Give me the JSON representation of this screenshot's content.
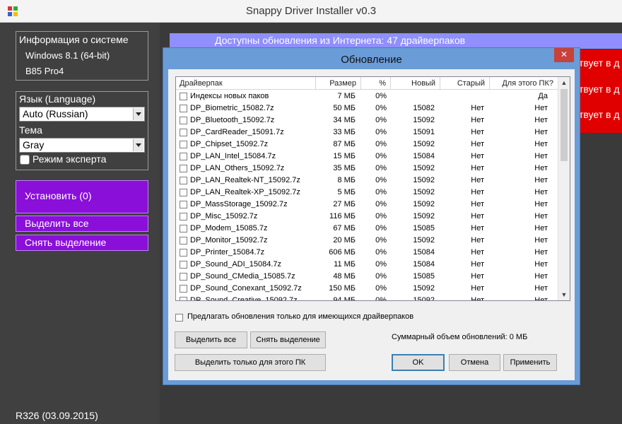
{
  "window": {
    "title": "Snappy Driver Installer v0.3"
  },
  "left_panel": {
    "system_info": {
      "heading": "Информация о системе",
      "os": "Windows 8.1 (64-bit)",
      "board": "B85 Pro4"
    },
    "language_label": "Язык (Language)",
    "language_value": "Auto (Russian)",
    "theme_label": "Тема",
    "theme_value": "Gray",
    "expert_mode_label": "Режим эксперта",
    "install_button": "Установить (0)",
    "select_all_button": "Выделить все",
    "deselect_button": "Снять выделение",
    "revision": "R326 (03.09.2015)"
  },
  "background": {
    "updates_banner": "Доступны обновления из Интернета: 47 драйверпаков",
    "red_rows": [
      "твует в д",
      "твует в д",
      "твует в д"
    ]
  },
  "dialog": {
    "title": "Обновление",
    "close_glyph": "✕",
    "columns": [
      "Драйверпак",
      "Размер",
      "%",
      "Новый",
      "Старый",
      "Для этого ПК?"
    ],
    "rows": [
      {
        "name": "Индексы новых паков",
        "size": "7 МБ",
        "pct": "0%",
        "new": "",
        "old": "",
        "for_pc": "Да"
      },
      {
        "name": "DP_Biometric_15082.7z",
        "size": "50 МБ",
        "pct": "0%",
        "new": "15082",
        "old": "Нет",
        "for_pc": "Нет"
      },
      {
        "name": "DP_Bluetooth_15092.7z",
        "size": "34 МБ",
        "pct": "0%",
        "new": "15092",
        "old": "Нет",
        "for_pc": "Нет"
      },
      {
        "name": "DP_CardReader_15091.7z",
        "size": "33 МБ",
        "pct": "0%",
        "new": "15091",
        "old": "Нет",
        "for_pc": "Нет"
      },
      {
        "name": "DP_Chipset_15092.7z",
        "size": "87 МБ",
        "pct": "0%",
        "new": "15092",
        "old": "Нет",
        "for_pc": "Нет"
      },
      {
        "name": "DP_LAN_Intel_15084.7z",
        "size": "15 МБ",
        "pct": "0%",
        "new": "15084",
        "old": "Нет",
        "for_pc": "Нет"
      },
      {
        "name": "DP_LAN_Others_15092.7z",
        "size": "35 МБ",
        "pct": "0%",
        "new": "15092",
        "old": "Нет",
        "for_pc": "Нет"
      },
      {
        "name": "DP_LAN_Realtek-NT_15092.7z",
        "size": "8 МБ",
        "pct": "0%",
        "new": "15092",
        "old": "Нет",
        "for_pc": "Нет"
      },
      {
        "name": "DP_LAN_Realtek-XP_15092.7z",
        "size": "5 МБ",
        "pct": "0%",
        "new": "15092",
        "old": "Нет",
        "for_pc": "Нет"
      },
      {
        "name": "DP_MassStorage_15092.7z",
        "size": "27 МБ",
        "pct": "0%",
        "new": "15092",
        "old": "Нет",
        "for_pc": "Нет"
      },
      {
        "name": "DP_Misc_15092.7z",
        "size": "116 МБ",
        "pct": "0%",
        "new": "15092",
        "old": "Нет",
        "for_pc": "Нет"
      },
      {
        "name": "DP_Modem_15085.7z",
        "size": "67 МБ",
        "pct": "0%",
        "new": "15085",
        "old": "Нет",
        "for_pc": "Нет"
      },
      {
        "name": "DP_Monitor_15092.7z",
        "size": "20 МБ",
        "pct": "0%",
        "new": "15092",
        "old": "Нет",
        "for_pc": "Нет"
      },
      {
        "name": "DP_Printer_15084.7z",
        "size": "606 МБ",
        "pct": "0%",
        "new": "15084",
        "old": "Нет",
        "for_pc": "Нет"
      },
      {
        "name": "DP_Sound_ADI_15084.7z",
        "size": "11 МБ",
        "pct": "0%",
        "new": "15084",
        "old": "Нет",
        "for_pc": "Нет"
      },
      {
        "name": "DP_Sound_CMedia_15085.7z",
        "size": "48 МБ",
        "pct": "0%",
        "new": "15085",
        "old": "Нет",
        "for_pc": "Нет"
      },
      {
        "name": "DP_Sound_Conexant_15092.7z",
        "size": "150 МБ",
        "pct": "0%",
        "new": "15092",
        "old": "Нет",
        "for_pc": "Нет"
      },
      {
        "name": "DP_Sound_Creative_15092.7z",
        "size": "94 МБ",
        "pct": "0%",
        "new": "15092",
        "old": "Нет",
        "for_pc": "Нет"
      }
    ],
    "only_existing_label": "Предлагать обновления только для имеющихся драйверпаков",
    "select_all_button": "Выделить все",
    "deselect_button": "Снять выделение",
    "select_for_pc_button": "Выделить только для этого ПК",
    "total_label": "Суммарный объем обновлений: 0 МБ",
    "ok_button": "OK",
    "cancel_button": "Отмена",
    "apply_button": "Применить"
  }
}
